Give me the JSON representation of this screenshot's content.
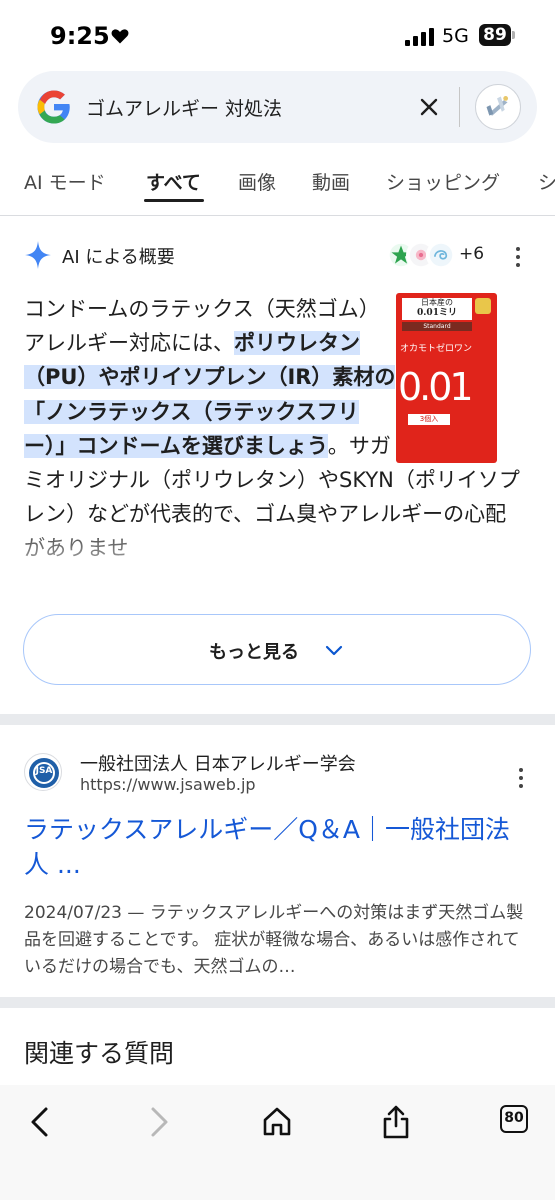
{
  "status_bar": {
    "time": "9:25",
    "network": "5G",
    "battery": "89"
  },
  "search": {
    "query": "ゴムアレルギー 対処法"
  },
  "tabs": [
    {
      "label": "AI モード"
    },
    {
      "label": "すべて"
    },
    {
      "label": "画像"
    },
    {
      "label": "動画"
    },
    {
      "label": "ショッピング"
    },
    {
      "label": "シ"
    }
  ],
  "ai_overview": {
    "title": "AI による概要",
    "sources_more": "+6",
    "text_plain_1": "コンドームのラテックス（天然ゴム）アレルギー対応には、",
    "text_highlight": "ポリウレタン（PU）やポリイソプレン（IR）素材の「ノンラテックス（ラテックスフリー）」コンドームを選びましょう",
    "text_plain_2": "。サガミオリジナル（ポリウレタン）やSKYN（ポリイソプレン）などが代表的で、ゴム臭やアレルギーの心配がありませ",
    "product_image": {
      "line1": "日本産の",
      "line2": "0.01ミリ",
      "line3": "Standard",
      "brand": "オカモトゼロワン",
      "big_number": "0.01",
      "count": "3個入"
    },
    "more_label": "もっと見る"
  },
  "result": {
    "site_name": "一般社団法人 日本アレルギー学会",
    "url": "https://www.jsaweb.jp",
    "favicon_text": "JSA",
    "title": "ラテックスアレルギー／Q＆A｜一般社団法人 ...",
    "snippet": "2024/07/23 — ラテックスアレルギーへの対策はまず天然ゴム製品を回避することです。 症状が軽微な場合、あるいは感作されているだけの場合でも、天然ゴムの…"
  },
  "related": {
    "heading": "関連する質問"
  },
  "toolbar": {
    "tab_count": "80"
  },
  "colors": {
    "link": "#1558d6",
    "highlight": "#d3e3fd",
    "accent_blue": "#4285f4"
  },
  "icons": [
    "heart-icon",
    "signal-icon",
    "google-logo",
    "clear-icon",
    "lens-icon",
    "ai-sparkle-icon",
    "kebab-icon",
    "chevron-down-icon",
    "back-icon",
    "forward-icon",
    "home-icon",
    "share-icon",
    "tabs-icon"
  ]
}
